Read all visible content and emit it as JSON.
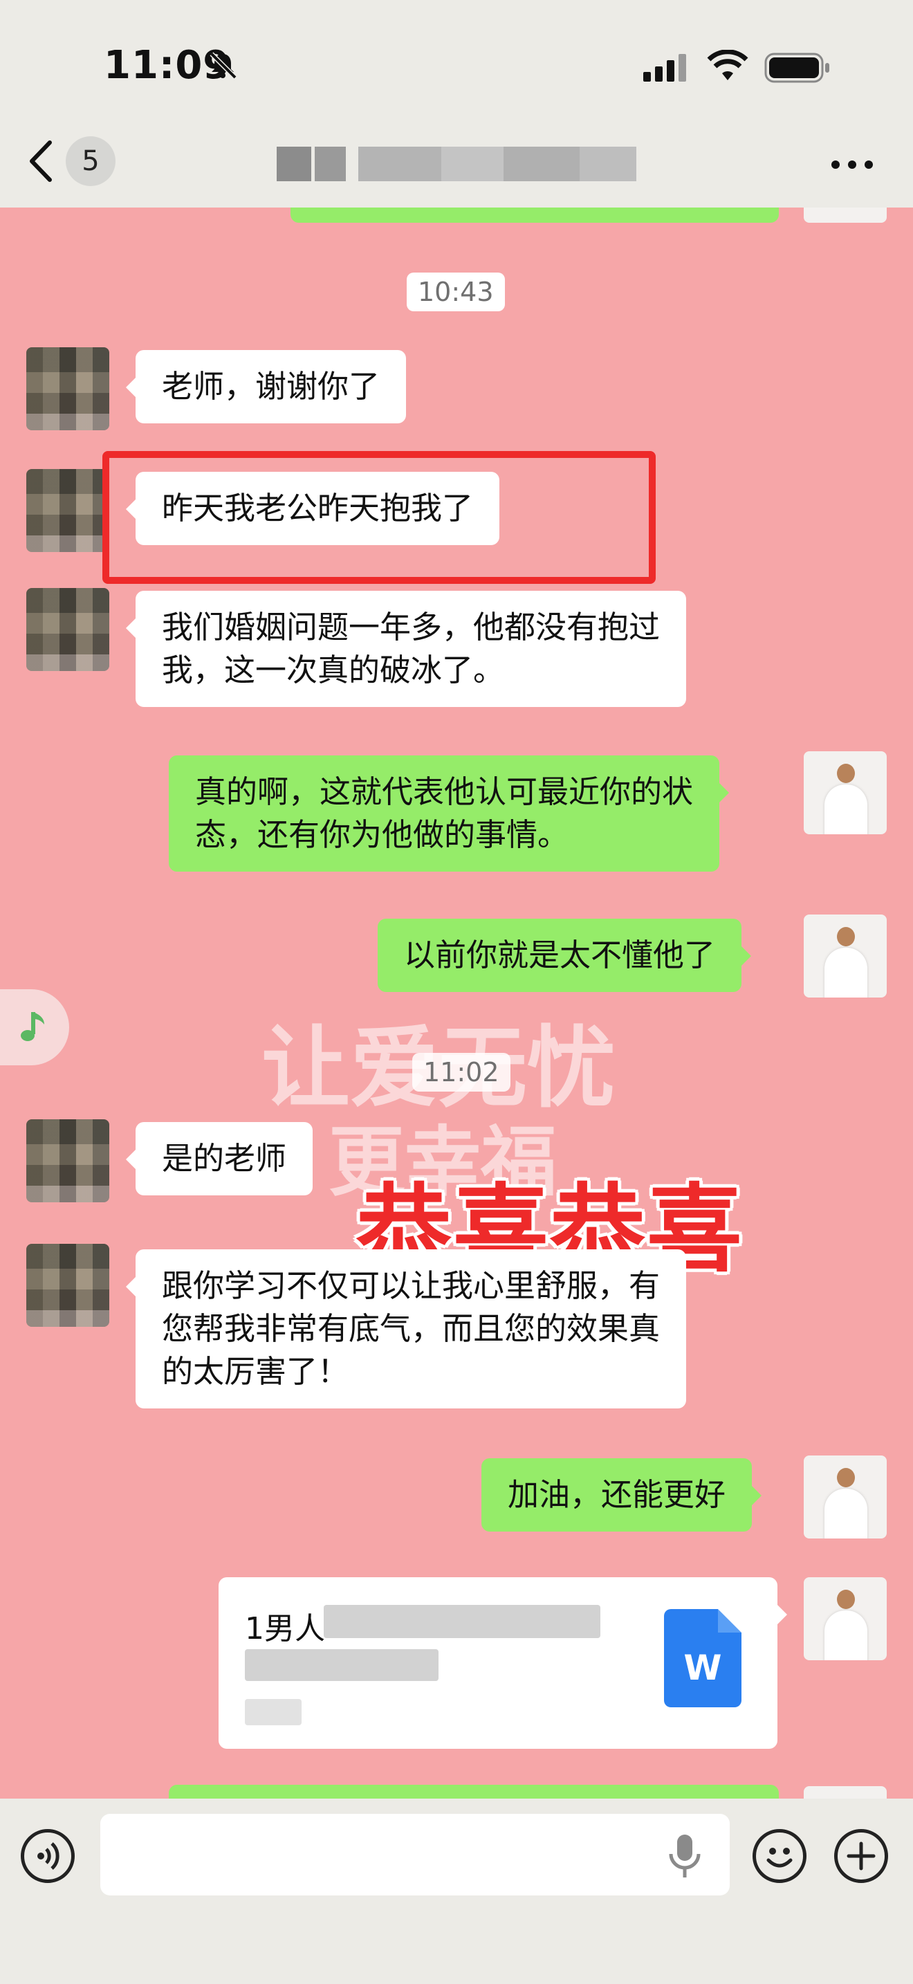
{
  "status_bar": {
    "time": "11:09"
  },
  "header": {
    "unread_count": "5"
  },
  "timestamps": [
    "10:43",
    "11:02"
  ],
  "messages": [
    {
      "side": "left",
      "text": "老师，谢谢你了"
    },
    {
      "side": "left",
      "text": "昨天我老公昨天抱我了"
    },
    {
      "side": "left",
      "lines": [
        "我们婚姻问题一年多，他都没有抱过",
        "我，这一次真的破冰了。"
      ]
    },
    {
      "side": "right",
      "lines": [
        "真的啊，这就代表他认可最近你的状",
        "态，还有你为他做的事情。"
      ]
    },
    {
      "side": "right",
      "text": "以前你就是太不懂他了"
    },
    {
      "side": "left",
      "text": "是的老师"
    },
    {
      "side": "left",
      "lines": [
        "跟你学习不仅可以让我心里舒服，有",
        "您帮我非常有底气，而且您的效果真",
        "的太厉害了！"
      ]
    },
    {
      "side": "right",
      "text": "加油，还能更好"
    }
  ],
  "file_message": {
    "name_visible": "1男人",
    "icon_letter": "W",
    "icon": "word-doc-icon"
  },
  "overlay": {
    "watermark_line1": "让爱无忧",
    "watermark_line2": "更幸福",
    "congrats": "恭喜恭喜"
  },
  "colors": {
    "chat_background": "#f6a6a8",
    "bubble_sent": "#95ec69",
    "bubble_received": "#ffffff",
    "highlight_box": "#ee2a2a"
  }
}
